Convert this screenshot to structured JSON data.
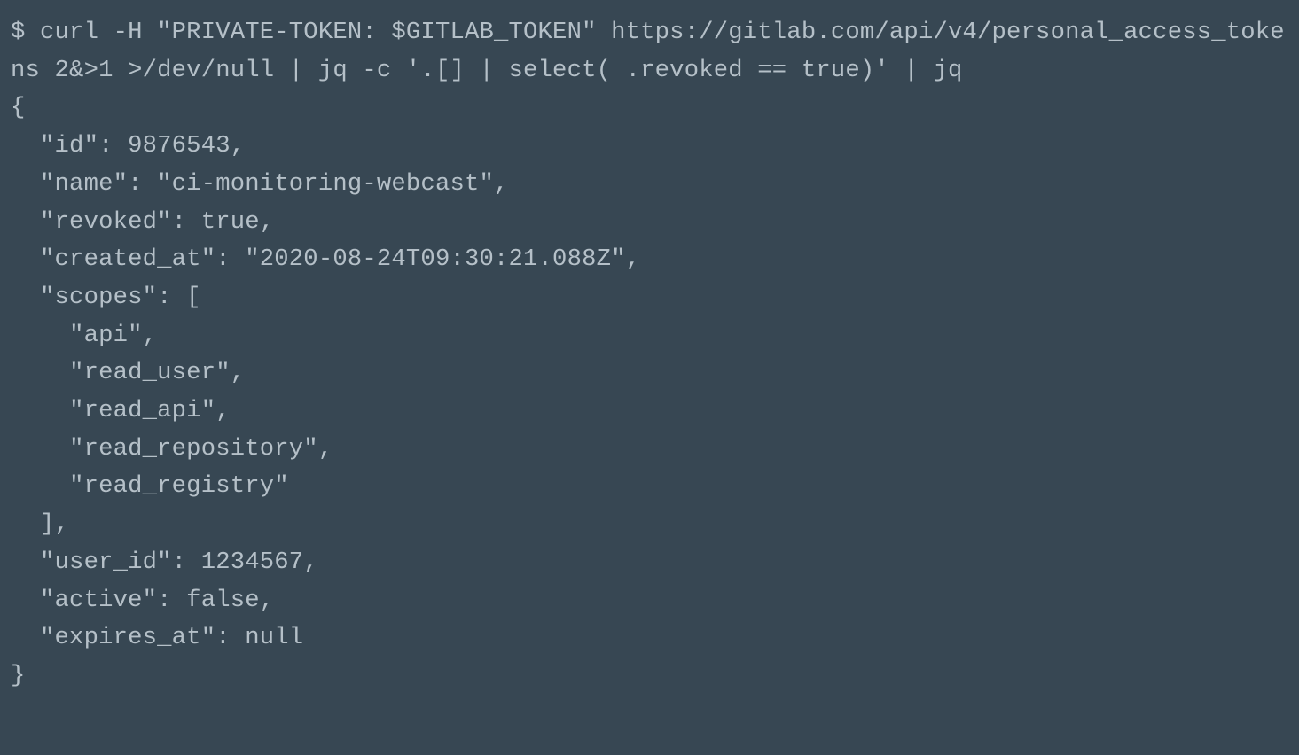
{
  "terminal": {
    "command_line_1": "$ curl -H \"PRIVATE-TOKEN: $GITLAB_TOKEN\" https://gitlab.com/api/v4/personal_access_tokens 2&>1 >/dev/null | jq -c '.[] | select( .revoked == true)' | jq",
    "output_open": "{",
    "output_id": "  \"id\": 9876543,",
    "output_name": "  \"name\": \"ci-monitoring-webcast\",",
    "output_revoked": "  \"revoked\": true,",
    "output_created_at": "  \"created_at\": \"2020-08-24T09:30:21.088Z\",",
    "output_scopes_open": "  \"scopes\": [",
    "output_scope_0": "    \"api\",",
    "output_scope_1": "    \"read_user\",",
    "output_scope_2": "    \"read_api\",",
    "output_scope_3": "    \"read_repository\",",
    "output_scope_4": "    \"read_registry\"",
    "output_scopes_close": "  ],",
    "output_user_id": "  \"user_id\": 1234567,",
    "output_active": "  \"active\": false,",
    "output_expires_at": "  \"expires_at\": null",
    "output_close": "}"
  }
}
